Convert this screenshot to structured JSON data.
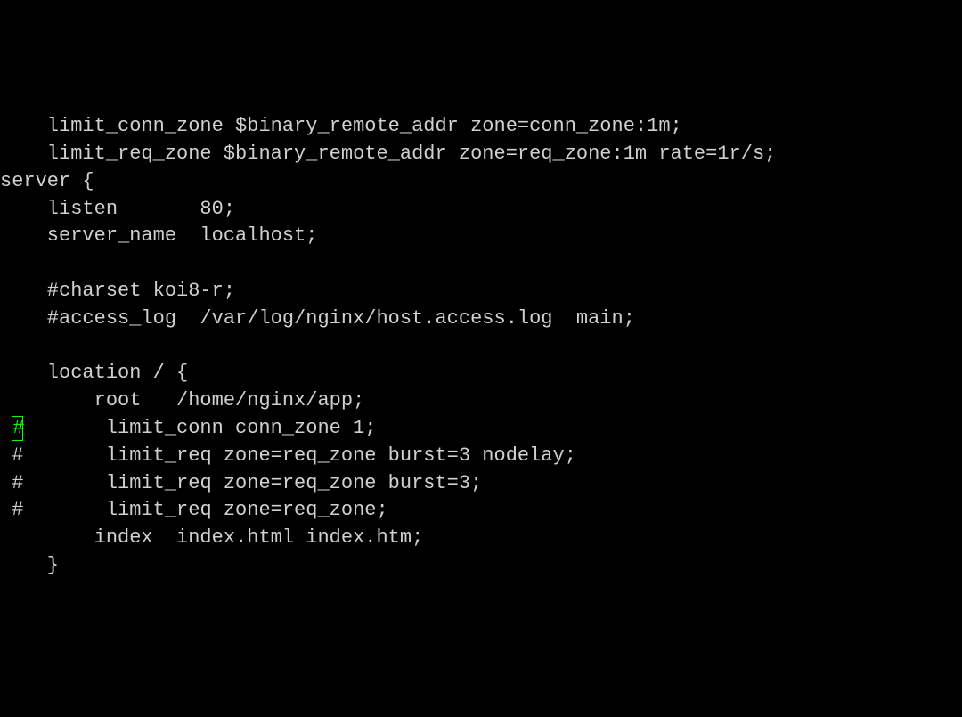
{
  "lines": [
    {
      "prefix": "",
      "indent": "    ",
      "text": "limit_conn_zone $binary_remote_addr zone=conn_zone:1m;"
    },
    {
      "prefix": "",
      "indent": "    ",
      "text": "limit_req_zone $binary_remote_addr zone=req_zone:1m rate=1r/s;"
    },
    {
      "prefix": "",
      "indent": "",
      "text": "server {"
    },
    {
      "prefix": "",
      "indent": "    ",
      "text": "listen       80;"
    },
    {
      "prefix": "",
      "indent": "    ",
      "text": "server_name  localhost;"
    },
    {
      "prefix": "",
      "indent": "",
      "text": ""
    },
    {
      "prefix": "",
      "indent": "    ",
      "text": "#charset koi8-r;"
    },
    {
      "prefix": "",
      "indent": "    ",
      "text": "#access_log  /var/log/nginx/host.access.log  main;"
    },
    {
      "prefix": "",
      "indent": "",
      "text": ""
    },
    {
      "prefix": "",
      "indent": "    ",
      "text": "location / {"
    },
    {
      "prefix": "",
      "indent": "        ",
      "text": "root   /home/nginx/app;"
    },
    {
      "prefix": "cursor",
      "prefixText": "#",
      "indent": "        ",
      "text": "limit_conn conn_zone 1;"
    },
    {
      "prefix": "plain",
      "prefixText": "#",
      "indent": "        ",
      "text": "limit_req zone=req_zone burst=3 nodelay;"
    },
    {
      "prefix": "plain",
      "prefixText": "#",
      "indent": "        ",
      "text": "limit_req zone=req_zone burst=3;"
    },
    {
      "prefix": "plain",
      "prefixText": "#",
      "indent": "        ",
      "text": "limit_req zone=req_zone;"
    },
    {
      "prefix": "",
      "indent": "        ",
      "text": "index  index.html index.htm;"
    },
    {
      "prefix": "",
      "indent": "    ",
      "text": "}"
    }
  ]
}
